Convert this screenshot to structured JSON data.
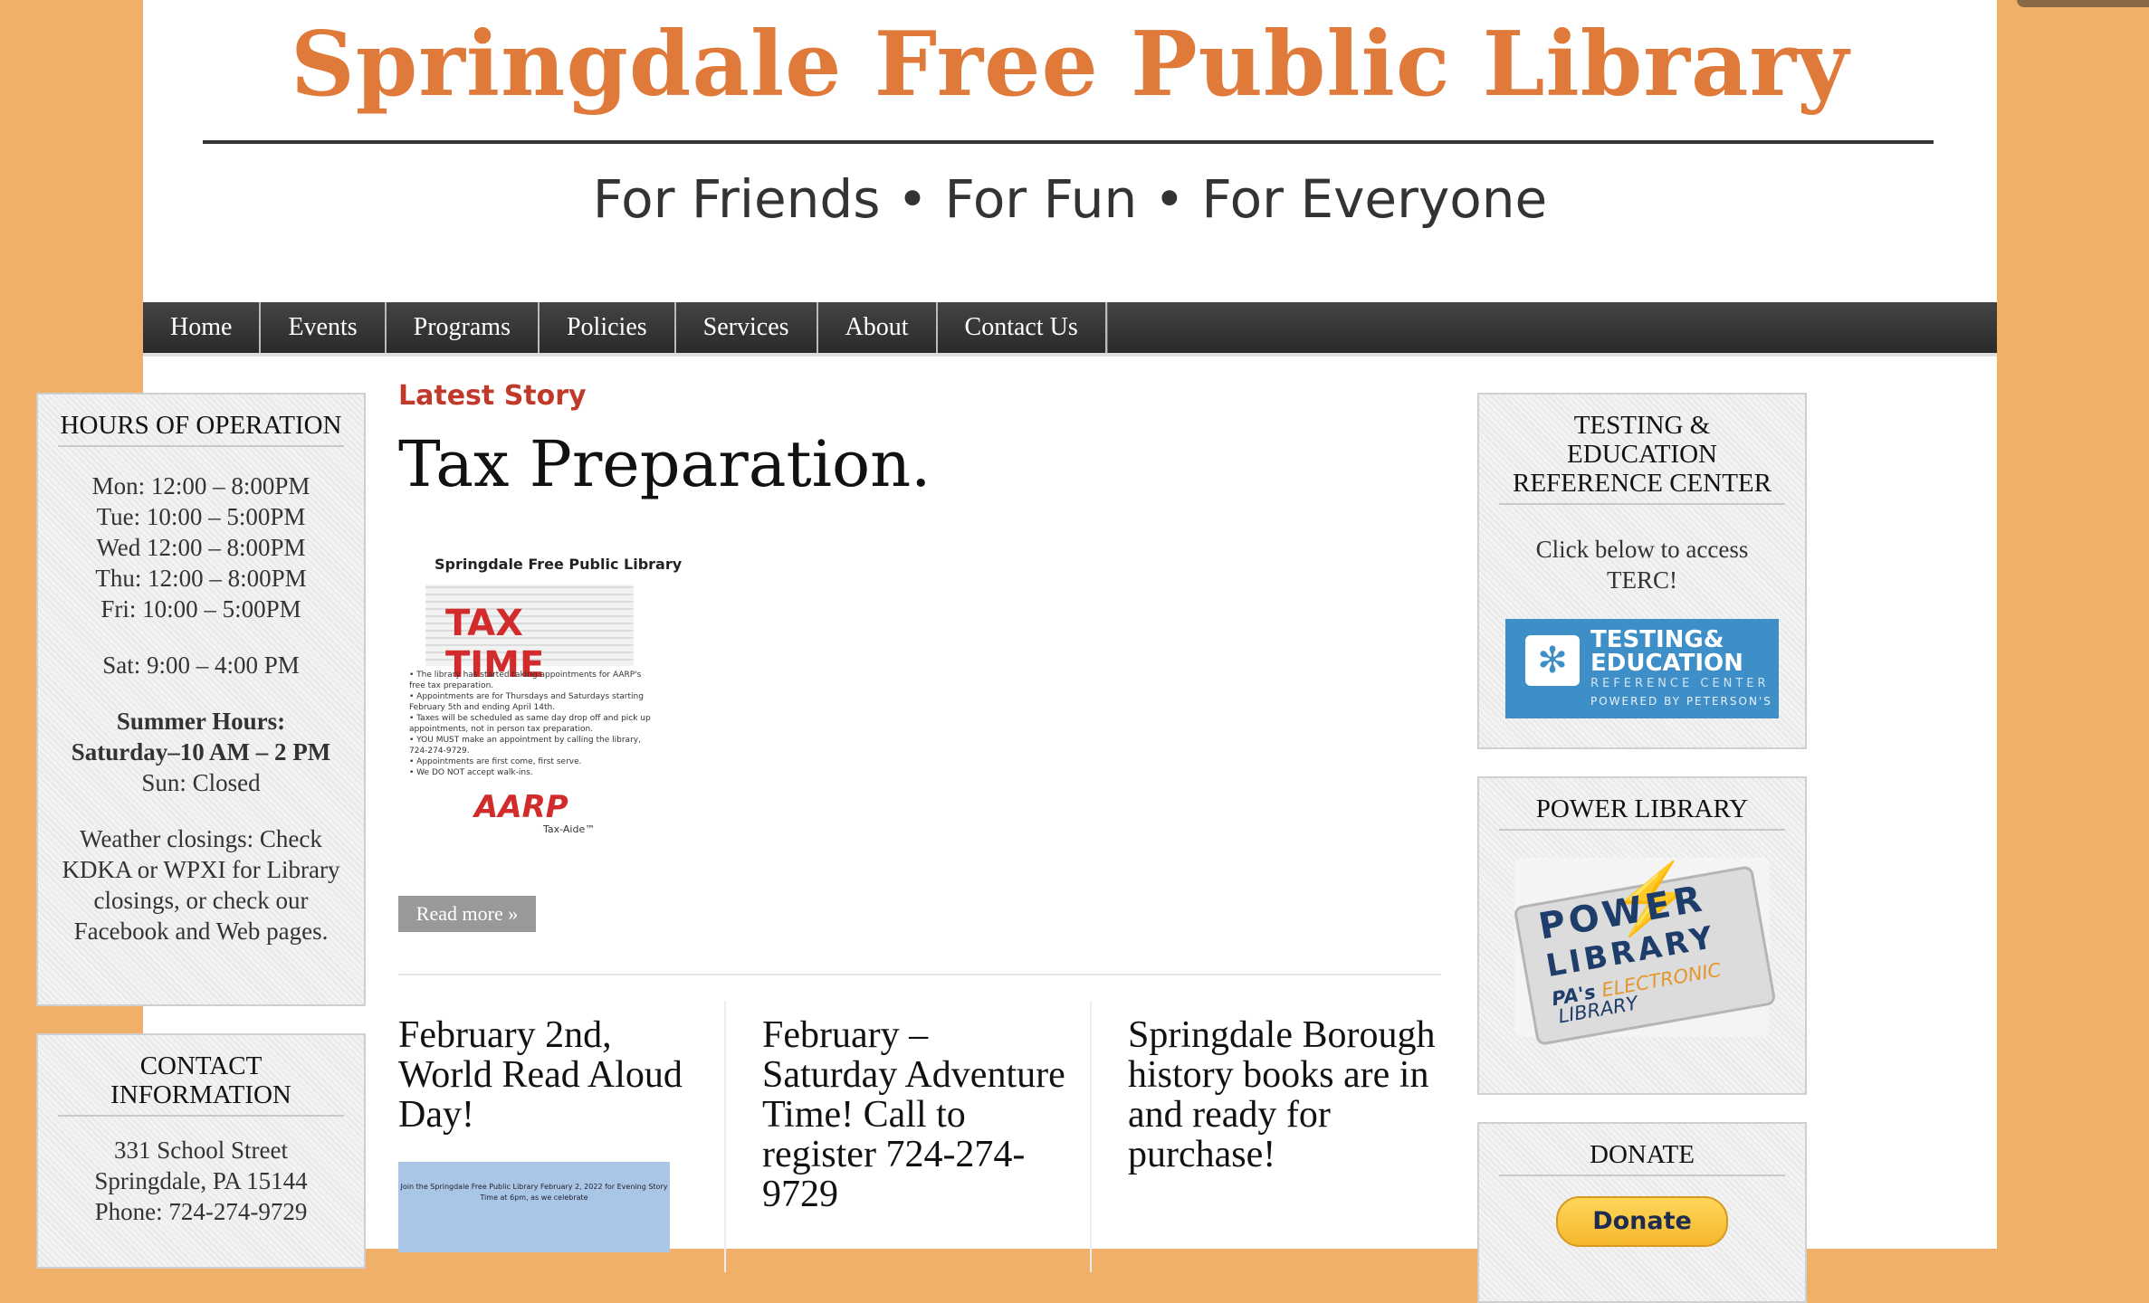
{
  "header": {
    "site_title": "Springdale Free Public Library",
    "tagline": "For Friends • For Fun • For Everyone"
  },
  "nav": {
    "items": [
      {
        "label": "Home"
      },
      {
        "label": "Events"
      },
      {
        "label": "Programs"
      },
      {
        "label": "Policies"
      },
      {
        "label": "Services"
      },
      {
        "label": "About"
      },
      {
        "label": "Contact Us"
      }
    ]
  },
  "hours": {
    "title": "HOURS OF OPERATION",
    "days": [
      "Mon: 12:00 – 8:00PM",
      "Tue: 10:00 – 5:00PM",
      "Wed 12:00 – 8:00PM",
      "Thu: 12:00 – 8:00PM",
      "Fri: 10:00 – 5:00PM"
    ],
    "saturday": "Sat: 9:00 – 4:00 PM",
    "summer_label": "Summer Hours:",
    "summer_hours": "Saturday–10 AM – 2 PM",
    "sunday": "Sun: Closed",
    "weather": "Weather closings: Check KDKA or WPXI for Library closings, or check our Facebook and Web pages."
  },
  "contact": {
    "title": "CONTACT INFORMATION",
    "street": "331 School Street",
    "city": "Springdale, PA 15144",
    "phone": "Phone: 724-274-9729"
  },
  "main": {
    "latest_label": "Latest Story",
    "story_title": "Tax Preparation.",
    "poster": {
      "heading": "Springdale Free Public Library",
      "big_text": "TAX TIME",
      "bullets": [
        "The library has started taking appointments for AARP's free tax preparation.",
        "Appointments are for Thursdays and Saturdays starting February 5th and ending April 14th.",
        "Taxes will be scheduled as same day drop off and pick up appointments, not in person tax preparation.",
        "YOU MUST make an appointment by calling the library, 724-274-9729.",
        "Appointments are first come, first serve.",
        "We DO NOT accept walk-ins."
      ],
      "aarp": "AARP",
      "aarp_sub": "Tax-Aide™"
    },
    "read_more": "Read more »",
    "posts": [
      {
        "title": "February 2nd, World Read Aloud Day!",
        "thumb_text": "Join the Springdale Free Public Library February 2, 2022 for Evening Story Time at 6pm, as we celebrate"
      },
      {
        "title": "February – Saturday Adventure Time! Call to register 724-274-9729"
      },
      {
        "title": "Springdale Borough history books are in and ready for purchase!"
      }
    ]
  },
  "sidebar_right": {
    "terc": {
      "title": "TESTING & EDUCATION REFERENCE CENTER",
      "desc": "Click below to access TERC!",
      "banner_line1": "TESTING&",
      "banner_line2": "EDUCATION",
      "banner_line3": "REFERENCE CENTER",
      "banner_line4": "POWERED BY PETERSON'S"
    },
    "power": {
      "title": "POWER LIBRARY",
      "logo_line1": "POWER",
      "logo_line2": "LIBRARY",
      "logo_line3a": "PA's ",
      "logo_line3b": "ELECTRONIC",
      "logo_line4": "LIBRARY"
    },
    "donate": {
      "title": "DONATE",
      "button": "Donate"
    }
  },
  "colors": {
    "page_background": "#f0b06a",
    "title_orange": "#e07a3a",
    "latest_red": "#c0392b",
    "nav_dark": "#333333",
    "terc_blue": "#3e8fc8"
  }
}
